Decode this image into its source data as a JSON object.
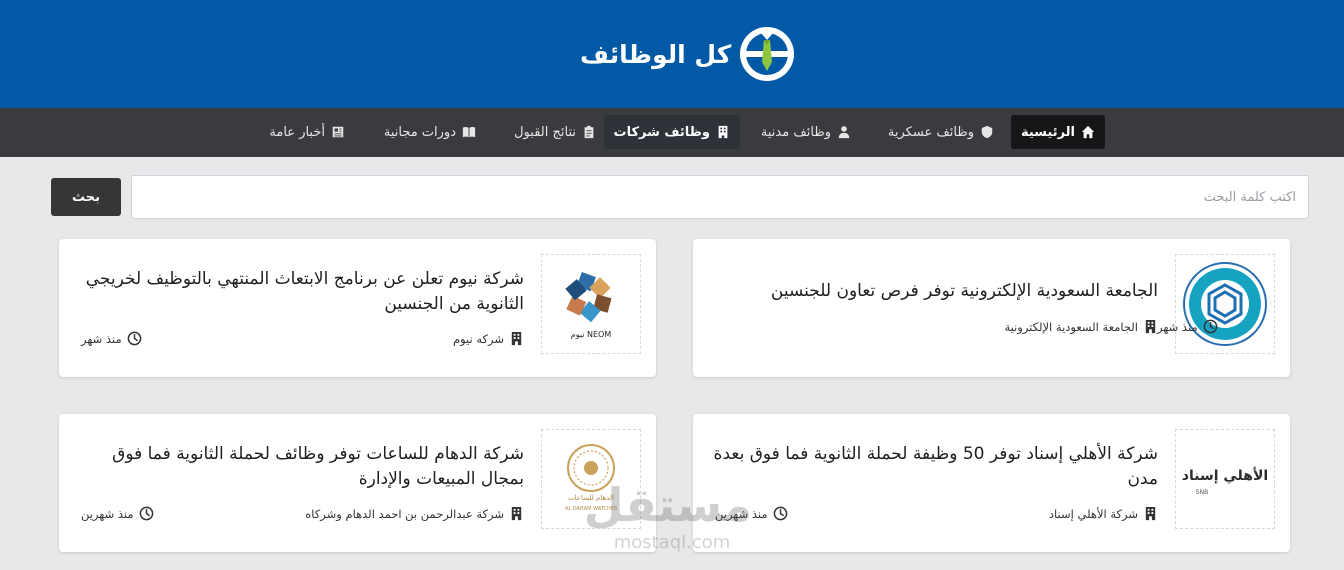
{
  "brand": {
    "name": "كل الوظائف"
  },
  "nav": [
    {
      "label": "الرئيسية",
      "icon": "home-icon"
    },
    {
      "label": "وظائف عسكرية",
      "icon": "shield-icon"
    },
    {
      "label": "وظائف مدنية",
      "icon": "user-icon"
    },
    {
      "label": "وظائف شركات",
      "icon": "building-icon"
    },
    {
      "label": "نتائج القبول",
      "icon": "clipboard-icon"
    },
    {
      "label": "دورات مجانية",
      "icon": "book-icon"
    },
    {
      "label": "أخبار عامة",
      "icon": "newspaper-icon"
    }
  ],
  "search": {
    "placeholder": "اكتب كلمة البحث",
    "button": "بحث"
  },
  "posts": [
    {
      "title": "الجامعة السعودية الإلكترونية توفر فرص تعاون للجنسين",
      "company": "الجامعة السعودية الإلكترونية",
      "time": "منذ شهر",
      "logo_text": "SAUDI ELECTRONIC UNIVERSITY"
    },
    {
      "title": "شركة نيوم تعلن عن برنامج الابتعاث المنتهي بالتوظيف لخريجي الثانوية من الجنسين",
      "company": "شركه نيوم",
      "time": "منذ شهر",
      "logo_text": "NEOM نيوم"
    },
    {
      "title": "شركة الأهلي إسناد توفر 50 وظيفة لحملة الثانوية فما فوق بعدة مدن",
      "company": "شركة الأهلي إسناد",
      "time": "منذ شهرين",
      "logo_text": "الأهلي إسناد",
      "logo_sub": "SNB"
    },
    {
      "title": "شركة الدهام للساعات توفر وظائف لحملة الثانوية فما فوق بمجال المبيعات والإدارة",
      "company": "شركة عبدالرحمن بن احمد الدهام وشركاه",
      "time": "منذ شهرين",
      "logo_text": "الدهام للساعات",
      "logo_sub": "AL DAHAM WATCHES"
    }
  ],
  "watermark": {
    "ar": "مستقل",
    "en": "mostaql.com"
  },
  "colors": {
    "header": "#0259a6",
    "nav": "#393b3e",
    "accent_green": "#8dc63f"
  }
}
